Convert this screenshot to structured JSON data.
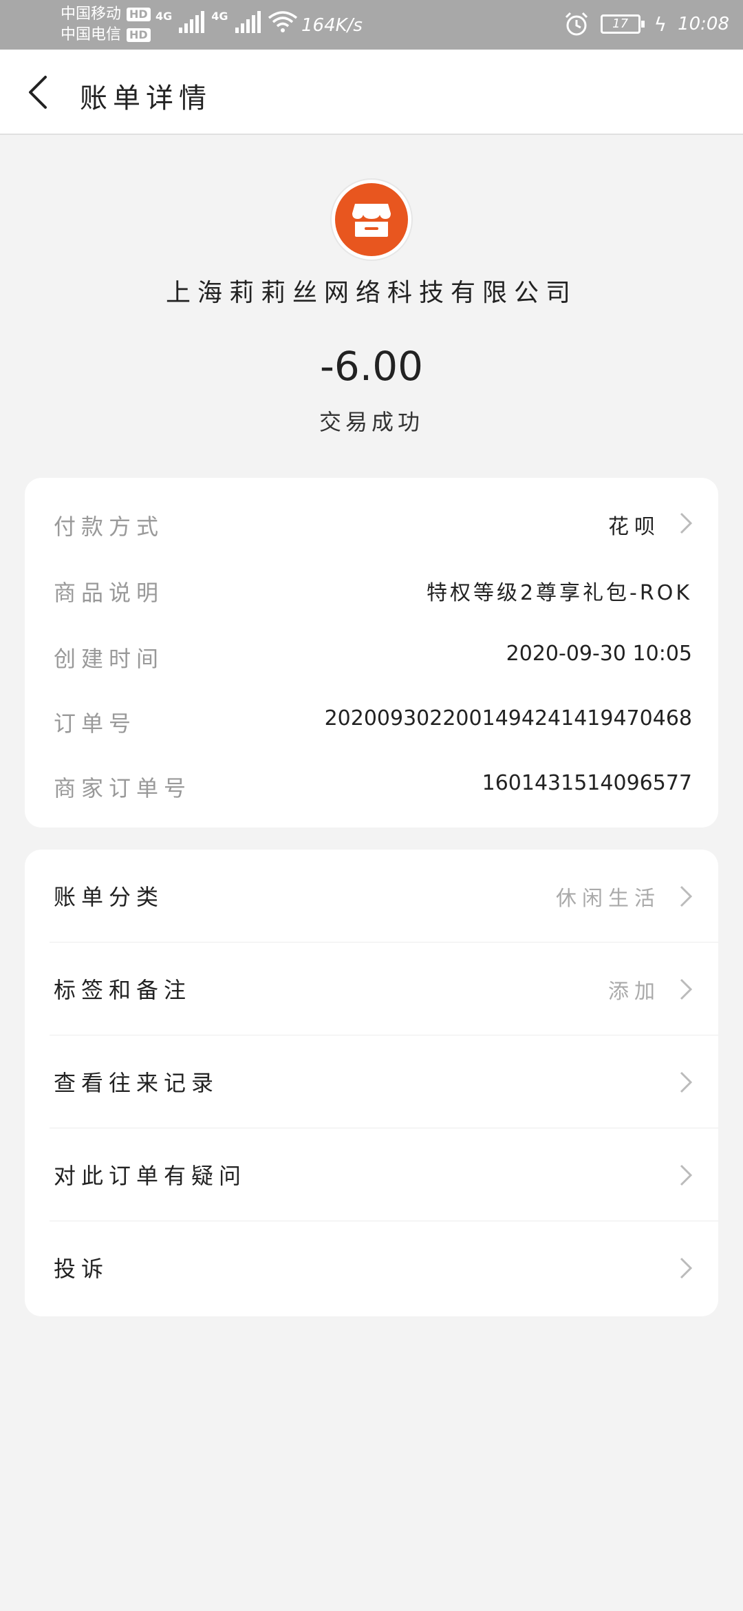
{
  "status_bar": {
    "carrier1": "中国移动",
    "carrier2": "中国电信",
    "hd_badge": "HD",
    "network_tag": "4G",
    "speed": "164K/s",
    "battery_level": "17",
    "time": "10:08"
  },
  "header": {
    "title": "账单详情"
  },
  "merchant": {
    "name": "上海莉莉丝网络科技有限公司",
    "amount": "-6.00",
    "status": "交易成功",
    "logo_color": "#e8561f"
  },
  "details": [
    {
      "label": "付款方式",
      "value": "花呗"
    },
    {
      "label": "商品说明",
      "value": "特权等级2尊享礼包-ROK"
    },
    {
      "label": "创建时间",
      "value": "2020-09-30 10:05"
    },
    {
      "label": "订单号",
      "value": "2020093022001494241419470468"
    },
    {
      "label": "商家订单号",
      "value": "1601431514096577"
    }
  ],
  "actions": [
    {
      "label": "账单分类",
      "value": "休闲生活"
    },
    {
      "label": "标签和备注",
      "value": "添加"
    },
    {
      "label": "查看往来记录",
      "value": ""
    },
    {
      "label": "对此订单有疑问",
      "value": ""
    },
    {
      "label": "投诉",
      "value": ""
    }
  ]
}
